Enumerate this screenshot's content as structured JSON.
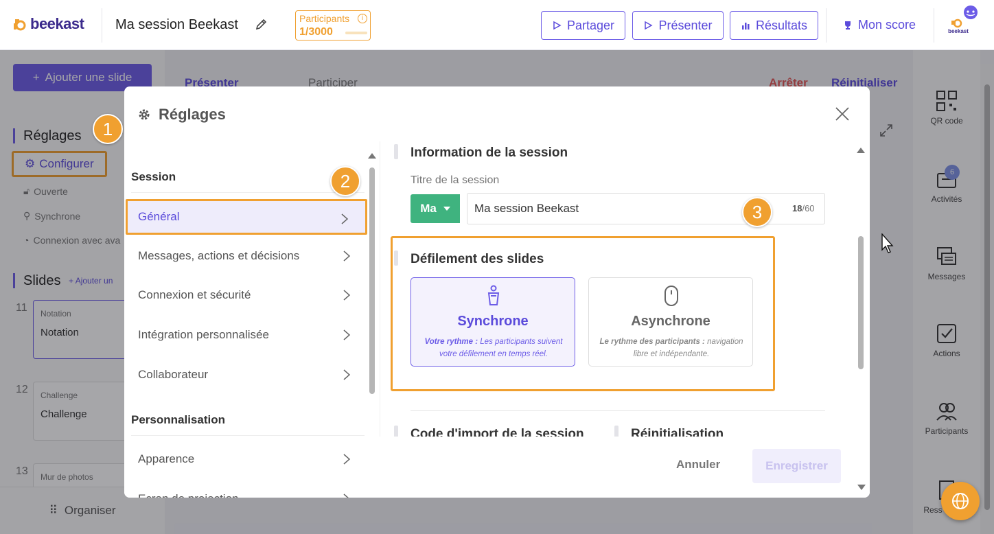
{
  "topbar": {
    "logo": "beekast",
    "session_title": "Ma session Beekast",
    "participants_label": "Participants",
    "participants_count": "1/3000",
    "info_glyph": "i",
    "buttons": [
      {
        "label": "Partager",
        "icon": "play-outline-icon"
      },
      {
        "label": "Présenter",
        "icon": "play-outline-icon"
      },
      {
        "label": "Résultats",
        "icon": "bar-chart-icon"
      }
    ],
    "score_label": "Mon score",
    "avatar_text": "beekast"
  },
  "left_panel": {
    "add_slide": "Ajouter une slide",
    "settings_title": "Réglages",
    "configure": "Configurer",
    "options": [
      "Ouverte",
      "Synchrone",
      "Connexion avec ava"
    ],
    "slides_title": "Slides",
    "add_link": "Ajouter un",
    "slides": [
      {
        "num": "11",
        "type": "Notation",
        "name": "Notation"
      },
      {
        "num": "12",
        "type": "Challenge",
        "name": "Challenge"
      },
      {
        "num": "13",
        "type": "Mur de photos",
        "name": ""
      }
    ],
    "organise": "Organiser"
  },
  "center": {
    "tab_present": "Présenter",
    "tab_participate": "Participer",
    "stop": "Arrêter",
    "reset": "Réinitialiser"
  },
  "right_panel": [
    {
      "label": "QR code",
      "icon": "qr-code-icon"
    },
    {
      "label": "Activités",
      "icon": "activities-icon",
      "badge": "6"
    },
    {
      "label": "Messages",
      "icon": "messages-icon"
    },
    {
      "label": "Actions",
      "icon": "check-square-icon"
    },
    {
      "label": "Participants",
      "icon": "participants-icon"
    },
    {
      "label": "Ress",
      "icon": "resources-icon"
    }
  ],
  "modal": {
    "title": "Réglages",
    "nav": {
      "section_session": "Session",
      "items": [
        "Général",
        "Messages, actions et décisions",
        "Connexion et sécurité",
        "Intégration personnalisée",
        "Collaborateur"
      ],
      "section_custom": "Personnalisation",
      "custom_items": [
        "Apparence",
        "Ecran de projection"
      ]
    },
    "content": {
      "info_title": "Information de la session",
      "title_label": "Titre de la session",
      "lang": "Ma",
      "title_value": "Ma session Beekast",
      "counter_current": "18",
      "counter_max": "/60",
      "scroll_title": "Défilement des slides",
      "modes": [
        {
          "title": "Synchrone",
          "desc_bold": "Votre rythme :",
          "desc": " Les participants suivent votre défilement en temps réel."
        },
        {
          "title": "Asynchrone",
          "desc_bold": "Le rythme des participants :",
          "desc": " navigation libre et indépendante."
        }
      ],
      "import_title": "Code d'import de la session",
      "reset_title": "Réinitialisation"
    },
    "footer": {
      "cancel": "Annuler",
      "save": "Enregistrer"
    }
  },
  "steps": [
    "1",
    "2",
    "3"
  ],
  "colors": {
    "accent": "#6c5ce7",
    "highlight": "#f0a030",
    "green": "#3fb37f"
  }
}
